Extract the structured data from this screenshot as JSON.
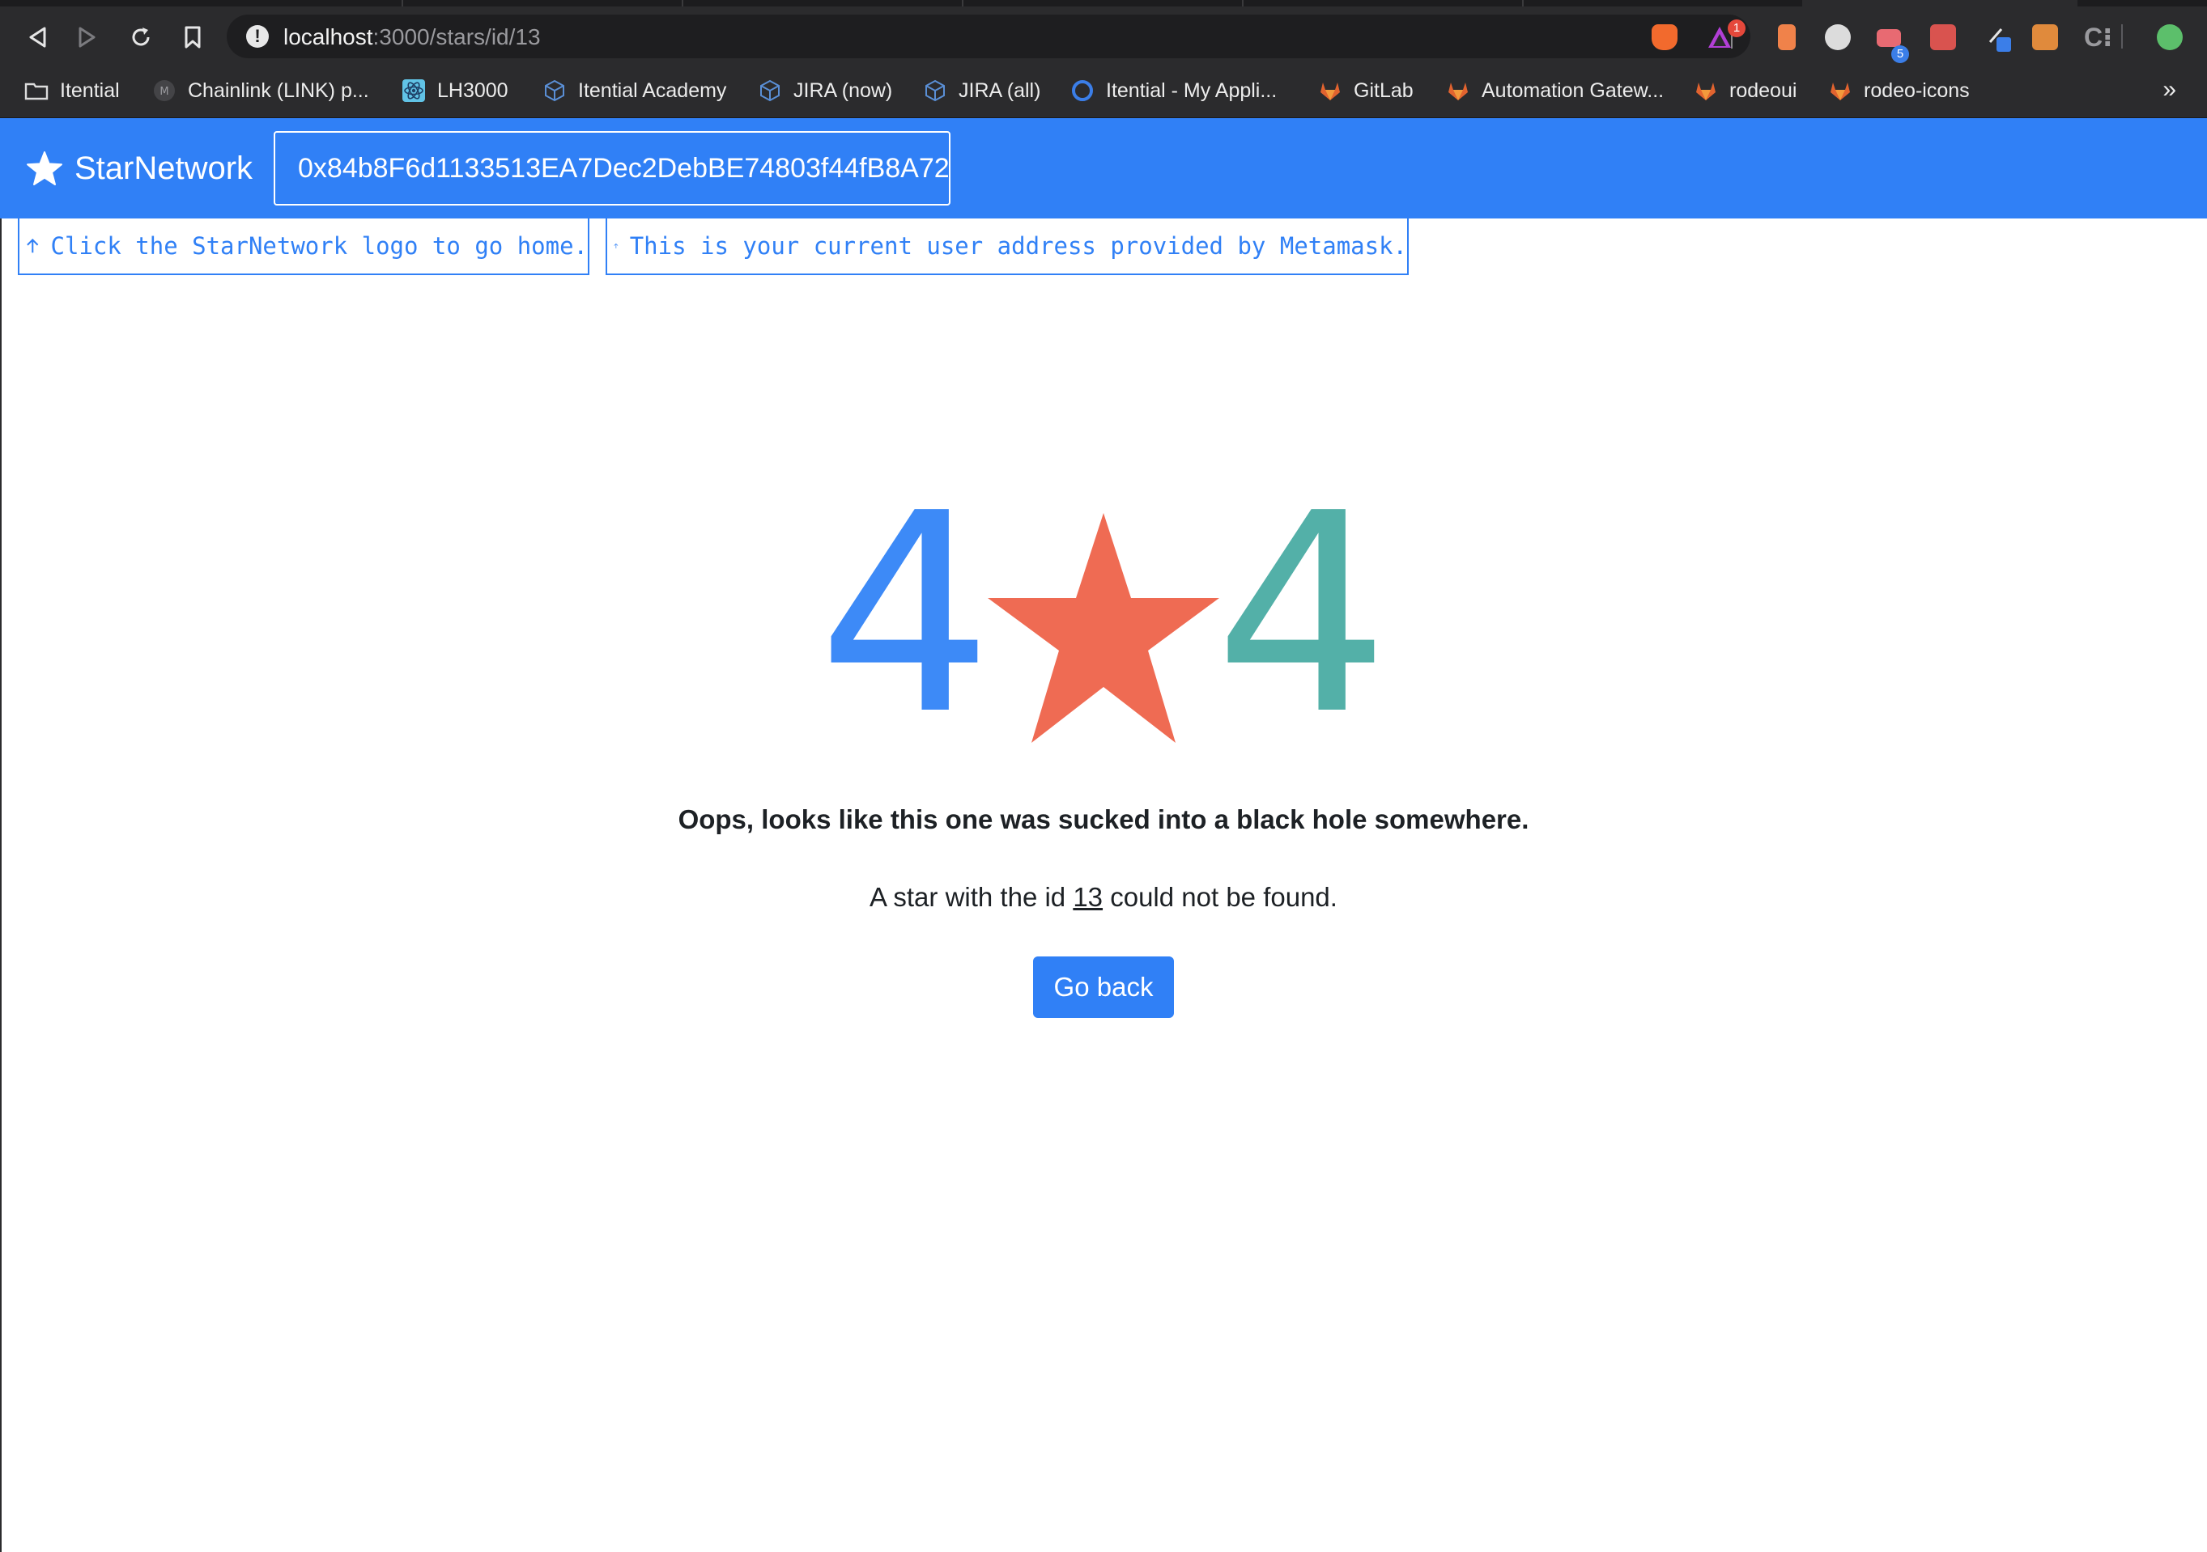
{
  "browser": {
    "url_host": "localhost",
    "url_path": ":3000/stars/id/13",
    "extension_badges": {
      "alert": "1",
      "tabs": "5"
    },
    "bookmarks": [
      {
        "label": "Itential",
        "icon": "folder-icon"
      },
      {
        "label": "Chainlink (LINK) p...",
        "icon": "chainlink-icon"
      },
      {
        "label": "LH3000",
        "icon": "react-icon"
      },
      {
        "label": "Itential Academy",
        "icon": "cube-icon"
      },
      {
        "label": "JIRA (now)",
        "icon": "cube-icon"
      },
      {
        "label": "JIRA (all)",
        "icon": "cube-icon"
      },
      {
        "label": "Itential - My Appli...",
        "icon": "ring-icon"
      },
      {
        "label": "GitLab",
        "icon": "gitlab-icon"
      },
      {
        "label": "Automation Gatew...",
        "icon": "gitlab-icon"
      },
      {
        "label": "rodeoui",
        "icon": "gitlab-icon"
      },
      {
        "label": "rodeo-icons",
        "icon": "gitlab-icon"
      }
    ],
    "more_label": "»"
  },
  "navbar": {
    "brand": "StarNetwork",
    "address": "0x84b8F6d1133513EA7Dec2DebBE74803f44fB8A72"
  },
  "hints": {
    "home": "Click the StarNetwork logo to go home.",
    "address": "This is your current user address provided by Metamask."
  },
  "notfound": {
    "digit_left": "4",
    "digit_right": "4",
    "headline": "Oops, looks like this one was sucked into a black hole somewhere.",
    "message_prefix": "A star with the id ",
    "star_id": "13",
    "message_suffix": " could not be found.",
    "button_label": "Go back"
  },
  "colors": {
    "primary": "#3080f6",
    "digit_left": "#3d8af7",
    "digit_right": "#53b0a8",
    "star": "#ef6b53"
  }
}
